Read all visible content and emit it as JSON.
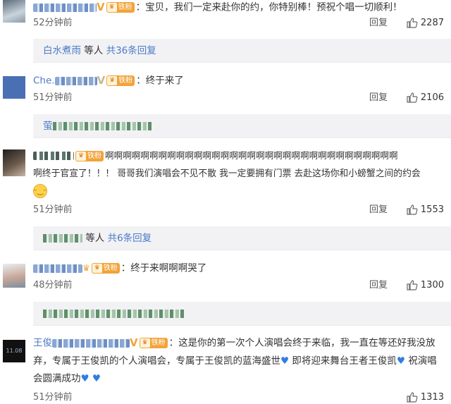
{
  "comments": [
    {
      "text": "：宝贝，我们一定来赴你的约，你特别棒！预祝个唱一切顺利！",
      "time": "52分钟前",
      "reply_label": "回复",
      "likes": "2287",
      "sub_reply": {
        "name": "白水煮雨",
        "connector": " 等人 ",
        "count_text": "共36条回复"
      }
    },
    {
      "user_prefix": "Che.",
      "badge": "铁粉",
      "text": "：终于来了",
      "time": "51分钟前",
      "reply_label": "回复",
      "likes": "2106",
      "sub_reply": {
        "name": "萤"
      }
    },
    {
      "badge": "铁粉",
      "text_line1": "啊啊啊啊啊啊啊啊啊啊啊啊啊啊啊啊啊啊啊啊啊啊啊啊啊啊啊啊啊啊啊啊啊",
      "text_line2": "啊终于官宣了！！！ 哥哥我们演唱会不见不散 我一定要拥有门票 去赴这场你和小螃蟹之间的约会",
      "time": "51分钟前",
      "reply_label": "回复",
      "likes": "1553",
      "sub_reply": {
        "connector": " 等人 ",
        "count_text": "共6条回复"
      }
    },
    {
      "badge": "铁粉",
      "text": "：终于来啊啊啊哭了",
      "time": "48分钟前",
      "reply_label": "回复",
      "likes": "1300"
    },
    {
      "user_prefix": "王俊",
      "badge": "铁粉",
      "text_line1": "：这是你的第一次个人演唱会终于来临，我一直在等还好我没放",
      "text_line2": "弃，专属于王俊凯的个人演唱会，专属于王俊凯的蓝海盛世",
      "text_line2b": " 即将迎来舞台王者王俊凯",
      "text_line2c": " 祝演唱",
      "text_line3": "会圆满成功",
      "time": "51分钟前",
      "likes": "1313",
      "avatar_text": "11.08"
    }
  ],
  "icons": {
    "like": "thumbs-up-icon",
    "emoji": "grin-emoji-icon",
    "heart": "blue-heart-icon",
    "crown": "crown-icon"
  },
  "colors": {
    "link": "#4a7bc7",
    "badge": "#f2a33a",
    "reply_bg": "#f2f2f5"
  }
}
